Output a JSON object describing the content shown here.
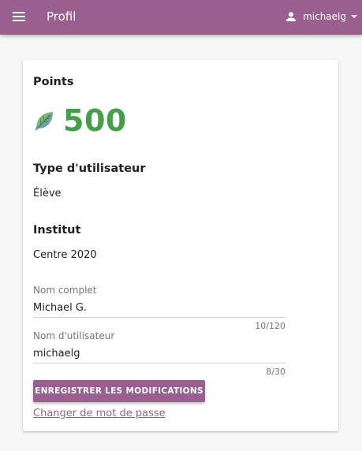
{
  "appbar": {
    "title": "Profil",
    "menu_icon": "menu-icon",
    "user_icon": "person-icon",
    "username": "michaelg"
  },
  "points": {
    "heading": "Points",
    "value": "500",
    "icon": "leaf-icon",
    "color": "#43a047"
  },
  "user_type": {
    "heading": "Type d'utilisateur",
    "value": "Élève"
  },
  "institute": {
    "heading": "Institut",
    "value": "Centre 2020"
  },
  "form": {
    "full_name": {
      "label": "Nom complet",
      "value": "Michael G.",
      "counter": "10/120"
    },
    "username": {
      "label": "Nom d'utilisateur",
      "value": "michaelg",
      "counter": "8/30"
    },
    "save_label": "ENREGISTRER LES MODIFICATIONS",
    "change_password_label": "Changer de mot de passe"
  },
  "colors": {
    "primary": "#9a5f8e",
    "points_green": "#43a047",
    "background": "#f6f6f6"
  }
}
